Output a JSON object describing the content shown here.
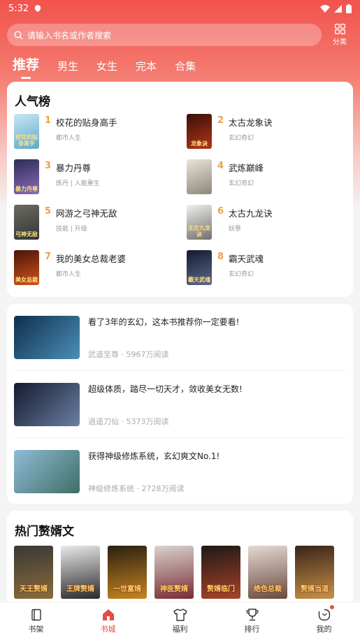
{
  "status_bar": {
    "time": "5:32"
  },
  "search": {
    "placeholder": "请输入书名或作者搜索"
  },
  "category_button": {
    "label": "分类"
  },
  "tabs": [
    {
      "label": "推荐",
      "active": true
    },
    {
      "label": "男生",
      "active": false
    },
    {
      "label": "女生",
      "active": false
    },
    {
      "label": "完本",
      "active": false
    },
    {
      "label": "合集",
      "active": false
    }
  ],
  "ranking": {
    "title": "人气榜",
    "items": [
      {
        "rank": "1",
        "name": "校花的贴身高手",
        "tag": "都市人生",
        "cover_text": "校花的贴身高手",
        "cover_colors": [
          "#cbe6f2",
          "#5aa9cf"
        ]
      },
      {
        "rank": "2",
        "name": "太古龙象诀",
        "tag": "玄幻奇幻",
        "cover_text": "龙象诀",
        "cover_colors": [
          "#3a1008",
          "#b2361a"
        ]
      },
      {
        "rank": "3",
        "name": "暴力丹尊",
        "tag": "炼丹 | 人能重生",
        "cover_text": "暴力丹尊",
        "cover_colors": [
          "#2a2d55",
          "#8d6cb8"
        ]
      },
      {
        "rank": "4",
        "name": "武炼巅峰",
        "tag": "玄幻奇幻",
        "cover_text": "",
        "cover_colors": [
          "#e9e4d8",
          "#8c8779"
        ]
      },
      {
        "rank": "5",
        "name": "网游之弓神无敌",
        "tag": "技能 | 升级",
        "cover_text": "弓神无敌",
        "cover_colors": [
          "#6d6b63",
          "#303533"
        ]
      },
      {
        "rank": "6",
        "name": "太古九龙诀",
        "tag": "妖孽",
        "cover_text": "太古九龙诀",
        "cover_colors": [
          "#f0f0ee",
          "#6f6f6f"
        ]
      },
      {
        "rank": "7",
        "name": "我的美女总裁老婆",
        "tag": "都市人生",
        "cover_text": "美女总裁",
        "cover_colors": [
          "#4a1208",
          "#d1561e"
        ]
      },
      {
        "rank": "8",
        "name": "霸天武魂",
        "tag": "玄幻奇幻",
        "cover_text": "霸天武魂",
        "cover_colors": [
          "#141a2e",
          "#5b6a8e"
        ]
      }
    ]
  },
  "feed": [
    {
      "title": "看了3年的玄幻，这本书推荐你一定要看!",
      "book": "武道至尊",
      "reads": "5967万阅读",
      "thumb_colors": [
        "#0e2f4a",
        "#4b8fb8"
      ]
    },
    {
      "title": "超级体质，踏尽一切天才，敛收美女无数!",
      "book": "逍遥刀仙",
      "reads": "5373万阅读",
      "thumb_colors": [
        "#131a2c",
        "#6a7fa5"
      ]
    },
    {
      "title": "获得神级修炼系统，玄幻爽文No.1!",
      "book": "神级修炼系统",
      "reads": "2728万阅读",
      "thumb_colors": [
        "#8fbcd6",
        "#3e6e67"
      ]
    }
  ],
  "feed_separator": "·",
  "hot": {
    "title": "热门赘婿文",
    "items": [
      {
        "cover_text": "天王赘婿",
        "colors": [
          "#3a3836",
          "#8a6c3a"
        ]
      },
      {
        "cover_text": "王牌赘婿",
        "colors": [
          "#e9e9e9",
          "#2a2a2a"
        ]
      },
      {
        "cover_text": "一世富婿",
        "colors": [
          "#2a1f12",
          "#c7861e"
        ]
      },
      {
        "cover_text": "神医赘婿",
        "colors": [
          "#d9d2cc",
          "#7a2c35"
        ]
      },
      {
        "cover_text": "赘婿临门",
        "colors": [
          "#1f1816",
          "#a8442a"
        ]
      },
      {
        "cover_text": "绝色总裁",
        "colors": [
          "#e5d9d2",
          "#6b4a3e"
        ]
      },
      {
        "cover_text": "赘婿当道",
        "colors": [
          "#3a2418",
          "#c79248"
        ]
      }
    ]
  },
  "bottom_nav": [
    {
      "label": "书架",
      "icon": "bookshelf-icon",
      "active": false
    },
    {
      "label": "书城",
      "icon": "home-icon",
      "active": true
    },
    {
      "label": "福利",
      "icon": "shirt-icon",
      "active": false
    },
    {
      "label": "排行",
      "icon": "trophy-icon",
      "active": false
    },
    {
      "label": "我的",
      "icon": "profile-icon",
      "active": false
    }
  ],
  "colors": {
    "accent": "#e94a42",
    "rank_number": "#e6a24a"
  }
}
